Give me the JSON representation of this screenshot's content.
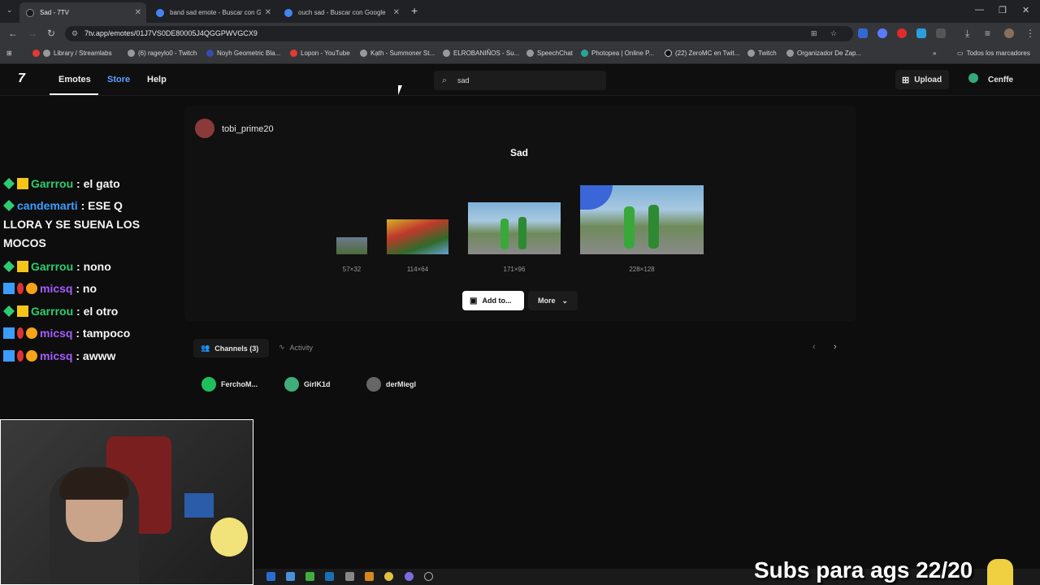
{
  "browser": {
    "tabs": [
      {
        "title": "Sad - 7TV",
        "active": true
      },
      {
        "title": "band sad emote - Buscar con G",
        "active": false
      },
      {
        "title": "ouch sad - Buscar con Google",
        "active": false
      }
    ],
    "new_tab": "+",
    "url": "7tv.app/emotes/01J7VS0DE80005J4QGGPWVGCX9",
    "bookmarks": [
      "Library / Streamlabs",
      "(6) rageylo0 - Twitch",
      "Noyh Geometric Bla...",
      "Lopon - YouTube",
      "Kạth - Summoner St...",
      "ELROBANIÑOS - Su...",
      "SpeechChat",
      "Photopea | Online P...",
      "(22) ZeroMC en Twit...",
      "Twitch",
      "Organizador De Zap..."
    ],
    "all_bookmarks": "Todos los marcadores"
  },
  "site": {
    "logo": "7",
    "nav": {
      "emotes": "Emotes",
      "store": "Store",
      "help": "Help"
    },
    "search_value": "sad",
    "upload": "Upload",
    "user": "Cenffe"
  },
  "emote": {
    "owner": "tobi_prime20",
    "name": "Sad",
    "sizes": [
      "57×32",
      "114×64",
      "171×96",
      "228×128"
    ],
    "add_button": "Add to...",
    "more_button": "More"
  },
  "tabs": {
    "channels": "Channels (3)",
    "activity": "Activity"
  },
  "channels": [
    "FerchoM...",
    "GirlK1d",
    "derMiegl"
  ],
  "chat": [
    {
      "user": "Garrrou",
      "msg": " : el gato",
      "color": "#2ecc71"
    },
    {
      "user": "candemarti",
      "msg": " : ESE Q",
      "color": "#3b9dff"
    },
    {
      "user": "",
      "msg": "LLORA Y SE SUENA LOS",
      "color": "#ffffff"
    },
    {
      "user": "",
      "msg": "MOCOS",
      "color": "#ffffff"
    },
    {
      "user": "Garrrou",
      "msg": " : nono",
      "color": "#2ecc71"
    },
    {
      "user": "micsq",
      "msg": " : no",
      "color": "#a45cff"
    },
    {
      "user": "Garrrou",
      "msg": " : el otro",
      "color": "#2ecc71"
    },
    {
      "user": "micsq",
      "msg": " : tampoco",
      "color": "#a45cff"
    },
    {
      "user": "micsq",
      "msg": " : awww",
      "color": "#a45cff"
    }
  ],
  "overlay": {
    "subs_text": "Subs para ags 22/20"
  },
  "colors": {
    "accent": "#ffffff",
    "store": "#5ea0ff",
    "bg": "#0d0d0d"
  }
}
